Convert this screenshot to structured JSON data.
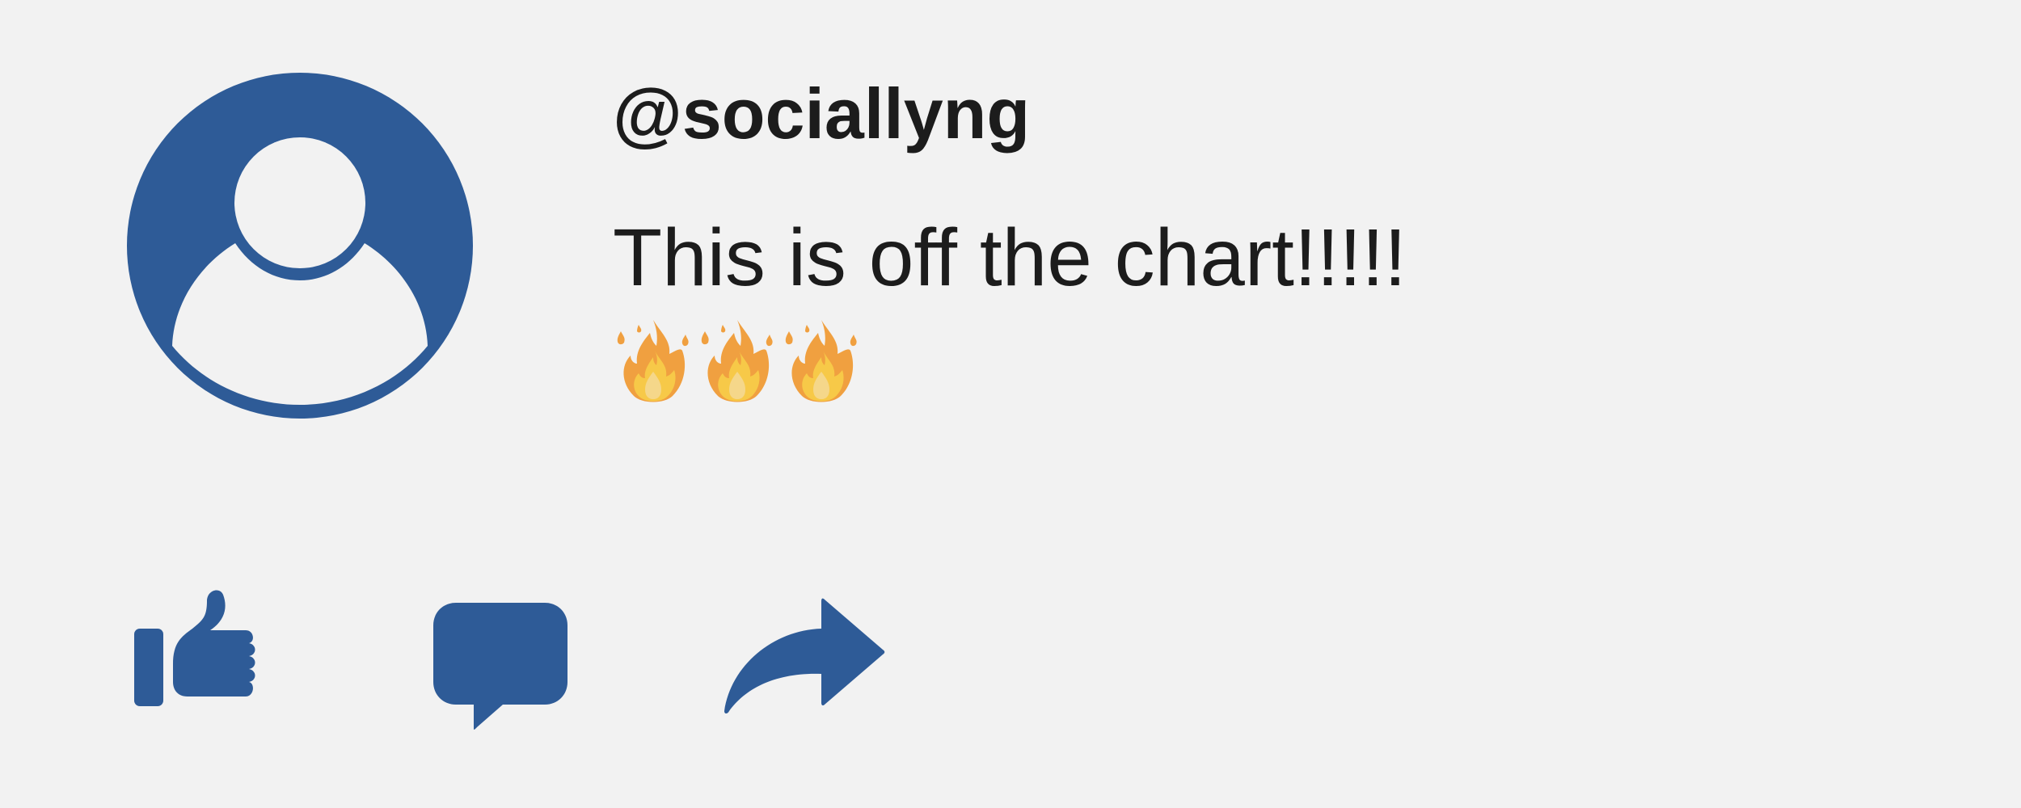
{
  "post": {
    "username": "@sociallyng",
    "message": "This is off the chart!!!!!",
    "emojis": [
      "fire-icon",
      "fire-icon",
      "fire-icon"
    ]
  },
  "actions": {
    "like": "thumbs-up-icon",
    "comment": "speech-bubble-icon",
    "share": "share-arrow-icon"
  },
  "colors": {
    "accent": "#2e5b97",
    "background": "#f2f2f2",
    "text": "#1c1c1c",
    "fire_outer": "#f0a040",
    "fire_inner": "#f7c948"
  }
}
